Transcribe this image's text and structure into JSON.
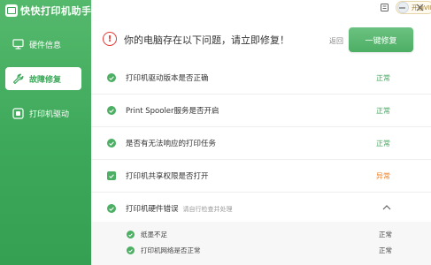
{
  "app": {
    "title": "快快打印机助手"
  },
  "sidebar": {
    "items": [
      {
        "label": "硬件信息",
        "icon": "monitor-icon",
        "active": false
      },
      {
        "label": "故障修复",
        "icon": "wrench-icon",
        "active": true
      },
      {
        "label": "打印机驱动",
        "icon": "driver-icon",
        "active": false
      }
    ]
  },
  "topbar": {
    "vip_label": "开通VIP"
  },
  "alert": {
    "message": "你的电脑存在以下问题，请立即修复！",
    "back_label": "返回",
    "fix_label": "一键修复"
  },
  "checks": [
    {
      "label": "打印机驱动版本是否正确",
      "status": "正常"
    },
    {
      "label": "Print Spooler服务是否开启",
      "status": "正常"
    },
    {
      "label": "是否有无法响应的打印任务",
      "status": "正常"
    },
    {
      "label": "打印机共享权限是否打开",
      "status": "异常"
    },
    {
      "label": "打印机硬件错误",
      "sub": "请自行检查并处理",
      "expanded": true
    }
  ],
  "subchecks": [
    {
      "label": "纸墨不足",
      "status": "正常"
    },
    {
      "label": "打印机网络是否正常",
      "status": "正常"
    }
  ],
  "colors": {
    "brand": "#3da85a",
    "ok": "#45a55e",
    "warn": "#ef7d22",
    "alert": "#e53935"
  }
}
